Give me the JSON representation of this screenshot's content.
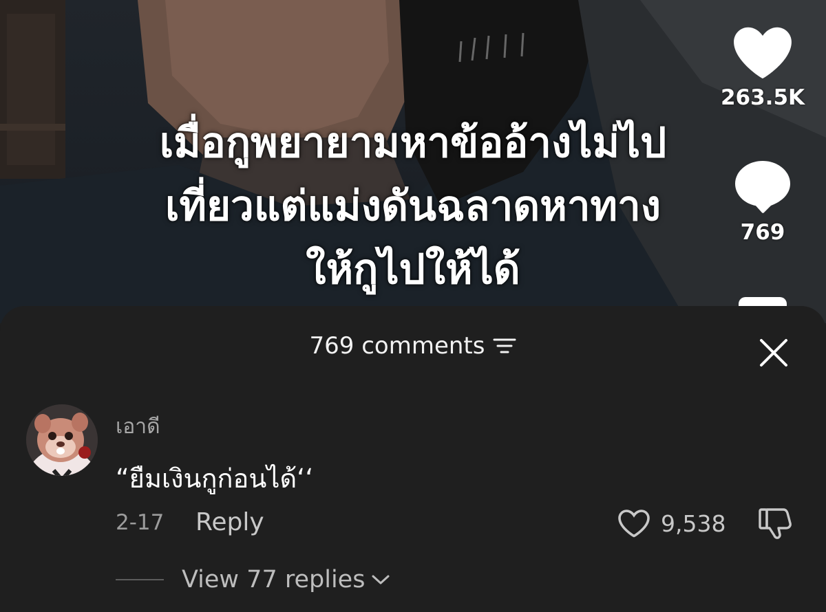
{
  "video": {
    "caption_lines": [
      "เมื่อกูพยายามหาข้ออ้างไม่ไป",
      "เที่ยวแต่แม่งดันฉลาดหาทาง",
      "ให้กูไปให้ได้"
    ],
    "likes": "263.5K",
    "comments": "769"
  },
  "sheet": {
    "title": "769 comments",
    "icons": {
      "sort": "sort-lines-icon",
      "close": "close-icon"
    }
  },
  "comment": {
    "username": "เอาดี",
    "text": "“ยืมเงินกูก่อนได้‘‘",
    "date": "2-17",
    "reply_label": "Reply",
    "like_count": "9,538",
    "view_replies": "View 77 replies"
  },
  "colors": {
    "sheet_bg": "#1f1f1f",
    "primary_text": "#ffffff",
    "secondary_text": "#a8a8a8"
  }
}
